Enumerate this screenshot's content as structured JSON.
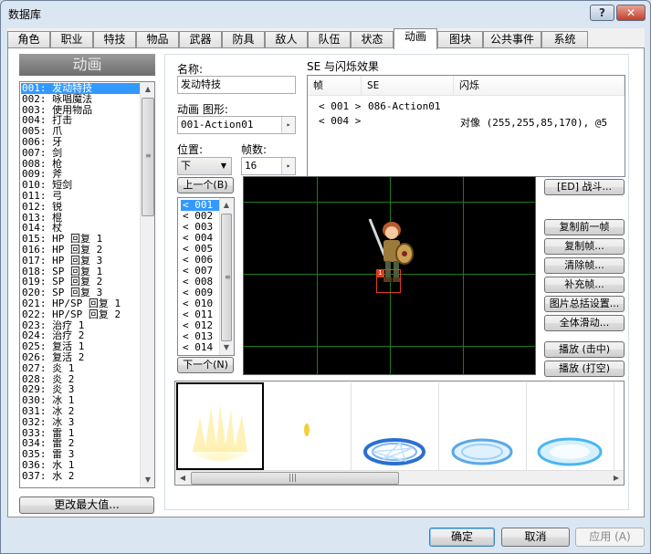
{
  "window": {
    "title": "数据库",
    "help": "?",
    "close": "✕"
  },
  "tabs": [
    "角色",
    "职业",
    "特技",
    "物品",
    "武器",
    "防具",
    "敌人",
    "队伍",
    "状态",
    "动画",
    "图块",
    "公共事件",
    "系统"
  ],
  "active_tab": 9,
  "list": {
    "header": "动画",
    "items": [
      "001: 发动特技",
      "002: 咏唱魔法",
      "003: 使用物品",
      "004: 打击",
      "005: 爪",
      "006: 牙",
      "007: 剑",
      "008: 枪",
      "009: 斧",
      "010: 短剑",
      "011: 弓",
      "012: 锐",
      "013: 棍",
      "014: 杖",
      "015: HP 回复 1",
      "016: HP 回复 2",
      "017: HP 回复 3",
      "018: SP 回复 1",
      "019: SP 回复 2",
      "020: SP 回复 3",
      "021: HP/SP 回复 1",
      "022: HP/SP 回复 2",
      "023: 治疗 1",
      "024: 治疗 2",
      "025: 复活 1",
      "026: 复活 2",
      "027: 炎 1",
      "028: 炎 2",
      "029: 炎 3",
      "030: 冰 1",
      "031: 冰 2",
      "032: 冰 3",
      "033: 雷 1",
      "034: 雷 2",
      "035: 雷 3",
      "036: 水 1",
      "037: 水 2"
    ],
    "selected": 0,
    "change_max_button": "更改最大值..."
  },
  "form": {
    "name_label": "名称:",
    "name_value": "发动特技",
    "graphic_label": "动画 图形:",
    "graphic_value": "001-Action01",
    "position_label": "位置:",
    "position_value": "下",
    "frames_label": "帧数:",
    "frames_value": "16"
  },
  "se_flash": {
    "label": "SE 与闪烁效果",
    "columns": [
      "帧",
      "SE",
      "闪烁"
    ],
    "rows": [
      {
        "frame": "< 001 >",
        "se": "086-Action01",
        "flash": ""
      },
      {
        "frame": "< 004 >",
        "se": "",
        "flash": "对像 (255,255,85,170), @5"
      }
    ]
  },
  "frames": {
    "prev_button": "上一个(B)",
    "next_button": "下一个(N)",
    "items": [
      "< 001",
      "< 002",
      "< 003",
      "< 004",
      "< 005",
      "< 006",
      "< 007",
      "< 008",
      "< 009",
      "< 010",
      "< 011",
      "< 012",
      "< 013",
      "< 014"
    ],
    "selected": 0
  },
  "battle_button": "[ED] 战斗...",
  "side_buttons": [
    "复制前一帧",
    "复制帧...",
    "清除帧...",
    "补充帧...",
    "图片总括设置...",
    "全体滑动..."
  ],
  "play_buttons": [
    "播放 (击中)",
    "播放 (打空)"
  ],
  "stage_marker": "1",
  "dialog_buttons": {
    "ok": "确定",
    "cancel": "取消",
    "apply": "应用 (A)"
  },
  "colors": {
    "selection": "#3399ff",
    "stage_bg": "#000000",
    "grid": "#1f7a1f"
  }
}
